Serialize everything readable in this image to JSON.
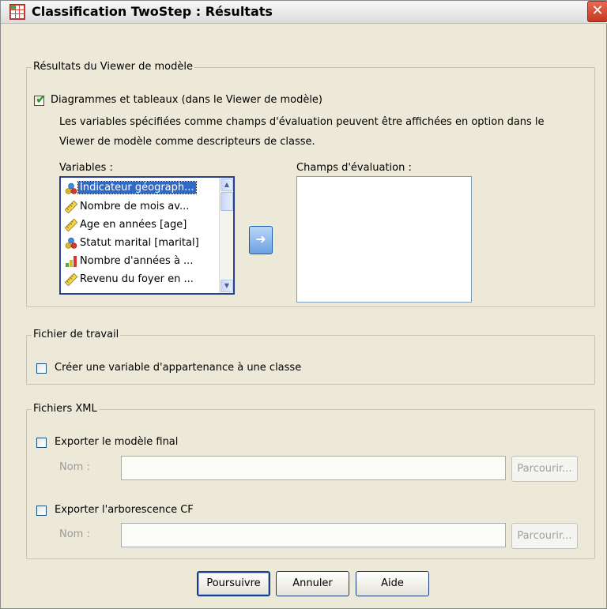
{
  "window": {
    "title": "Classification TwoStep : Résultats",
    "close_symbol": "✕"
  },
  "model_viewer": {
    "legend": "Résultats du Viewer de modèle",
    "checkbox_label": "Diagrammes et tableaux (dans le Viewer de modèle)",
    "checkbox_checked": true,
    "description_line1": "Les variables spécifiées comme champs d'évaluation peuvent être affichées en option dans le",
    "description_line2": "Viewer de modèle comme descripteurs de classe.",
    "variables_label": "Variables :",
    "variables": [
      {
        "label": "Indicateur géograph...",
        "icon": "nominal-icon",
        "selected": true
      },
      {
        "label": "Nombre de mois av...",
        "icon": "scale-icon",
        "selected": false
      },
      {
        "label": "Age en années [age]",
        "icon": "scale-icon",
        "selected": false
      },
      {
        "label": "Statut marital [marital]",
        "icon": "nominal-icon",
        "selected": false
      },
      {
        "label": "Nombre d'années à ...",
        "icon": "ordinal-icon",
        "selected": false
      },
      {
        "label": "Revenu du foyer en ...",
        "icon": "scale-icon",
        "selected": false
      }
    ],
    "move_symbol": "➜",
    "evaluation_label": "Champs d'évaluation :"
  },
  "working_file": {
    "legend": "Fichier de travail",
    "checkbox_label": "Créer une variable d'appartenance à une classe",
    "checkbox_checked": false
  },
  "xml_files": {
    "legend": "Fichiers XML",
    "export_model": {
      "checkbox_label": "Exporter le modèle final",
      "checkbox_checked": false,
      "name_label": "Nom :",
      "name_value": "",
      "browse_label": "Parcourir..."
    },
    "export_tree": {
      "checkbox_label": "Exporter l'arborescence CF",
      "checkbox_checked": false,
      "name_label": "Nom :",
      "name_value": "",
      "browse_label": "Parcourir..."
    }
  },
  "buttons": {
    "continue": "Poursuivre",
    "cancel": "Annuler",
    "help": "Aide"
  },
  "colors": {
    "dialog_bg": "#ece9d8",
    "selection": "#316ac5",
    "check_green": "#21a121"
  }
}
